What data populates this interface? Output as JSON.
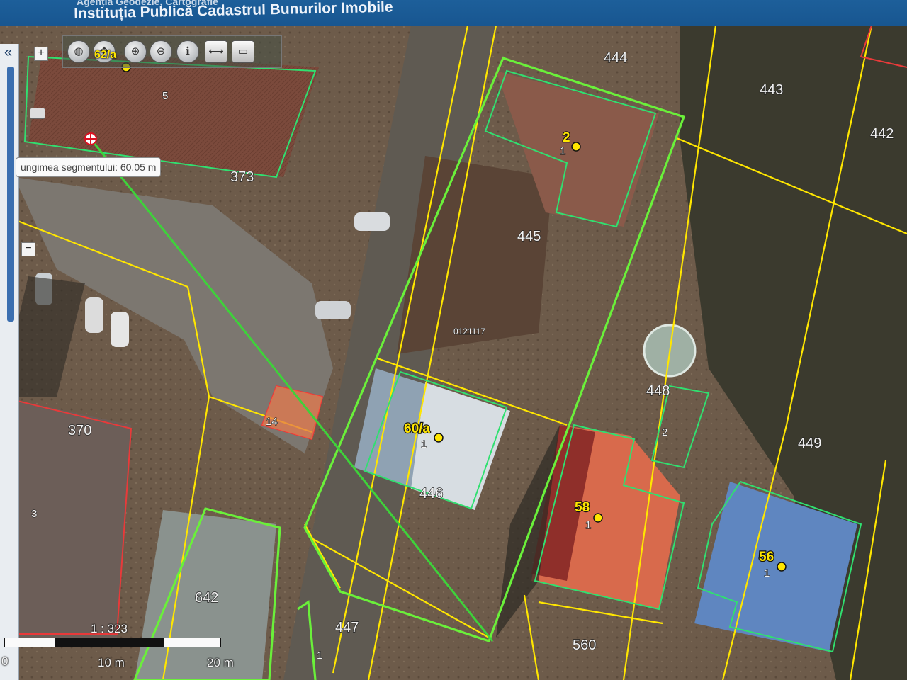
{
  "header": {
    "agency": "Agenția Geodezie, Cartografie",
    "institution": "Instituția Publică Cadastrul Bunurilor Imobile"
  },
  "panel": {
    "collapse": "«"
  },
  "toolbar": {
    "tools": [
      {
        "name": "globe-icon",
        "glyph": "◍"
      },
      {
        "name": "pan-icon",
        "glyph": "✥"
      },
      {
        "name": "zoom-in-icon",
        "glyph": "⊕"
      },
      {
        "name": "zoom-out-icon",
        "glyph": "⊖"
      },
      {
        "name": "info-icon",
        "glyph": "ℹ"
      },
      {
        "name": "measure-icon",
        "glyph": "⟷"
      },
      {
        "name": "area-icon",
        "glyph": "▭"
      }
    ],
    "zoom_in": "+",
    "zoom_out": "−",
    "active_label": "62/a"
  },
  "measure": {
    "tooltip": "ungimea segmentului: 60.05 m"
  },
  "map": {
    "cadastral_zone": "0121117",
    "parcels": [
      "444",
      "443",
      "442",
      "445",
      "373",
      "5",
      "448",
      "2",
      "449",
      "370",
      "3",
      "14",
      "446",
      "642",
      "447",
      "560"
    ],
    "buildings": [
      {
        "number": "2",
        "sub": "1"
      },
      {
        "number": "60/a",
        "sub": "1"
      },
      {
        "number": "58",
        "sub": "1"
      },
      {
        "number": "56",
        "sub": "1"
      }
    ],
    "extra": "1"
  },
  "scale": {
    "ratio": "1 : 323",
    "label_10": "10 m",
    "label_20": "20 m",
    "label_0": "0"
  },
  "colors": {
    "parcel_line": "#ffe600",
    "building_line": "#30e070",
    "selected_parcel": "#6af03a",
    "measure_line": "#3ed23a",
    "red_parcel": "#e83a3a",
    "header": "#1a5a96"
  }
}
